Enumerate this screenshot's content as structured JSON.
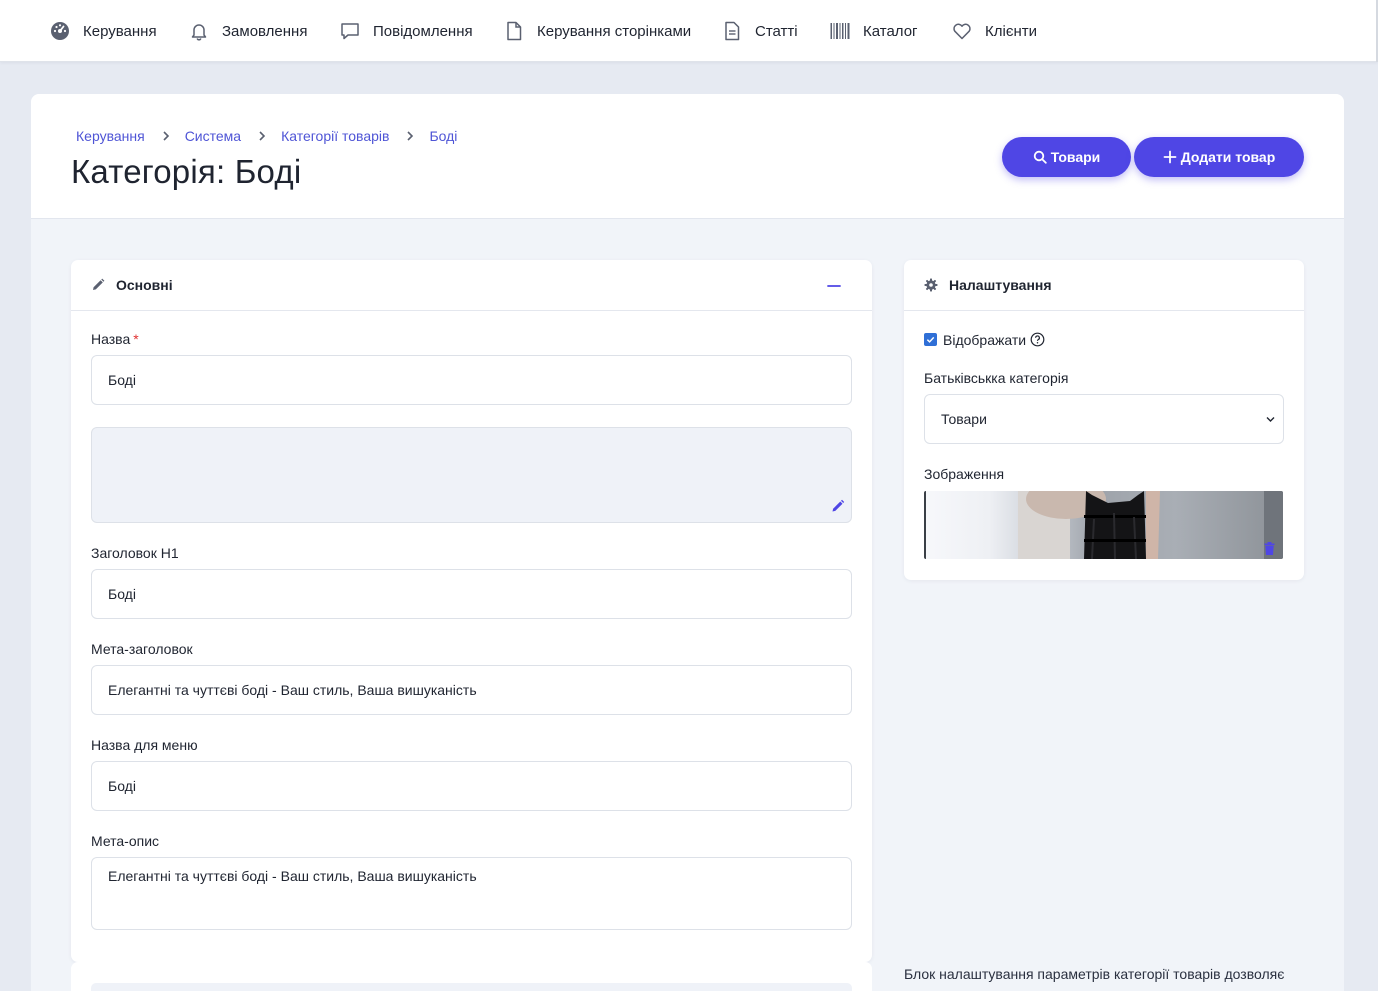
{
  "nav": {
    "items": [
      {
        "label": "Керування",
        "icon": "dashboard-icon"
      },
      {
        "label": "Замовлення",
        "icon": "bell-icon"
      },
      {
        "label": "Повідомлення",
        "icon": "chat-bubble-icon"
      },
      {
        "label": "Керування сторінками",
        "icon": "file-icon"
      },
      {
        "label": "Статті",
        "icon": "document-icon"
      },
      {
        "label": "Каталог",
        "icon": "barcode-icon"
      },
      {
        "label": "Клієнти",
        "icon": "heart-icon"
      }
    ]
  },
  "header": {
    "breadcrumb": [
      "Керування",
      "Система",
      "Категорії товарів",
      "Боді"
    ],
    "title": "Категорія: Боді",
    "products_button": "Товари",
    "add_product_button": "Додати товар"
  },
  "main_panel": {
    "title": "Основні",
    "name_label": "Назва",
    "required_mark": "*",
    "name_value": "Боді",
    "h1_label": "Заголовок H1",
    "h1_value": "Боді",
    "meta_title_label": "Мета-заголовок",
    "meta_title_value": "Елегантні та чуттєві боді - Ваш стиль, Ваша вишуканість",
    "menu_name_label": "Назва для меню",
    "menu_name_value": "Боді",
    "meta_desc_label": "Мета-опис",
    "meta_desc_value": "Елегантні та чуттєві боді - Ваш стиль, Ваша вишуканість"
  },
  "settings_panel": {
    "title": "Налаштування",
    "display_label": "Відображати",
    "display_checked": true,
    "parent_label": "Батьківськка категорія",
    "parent_value": "Товари",
    "image_label": "Зображення"
  },
  "info_text": "Блок налаштування параметрів категорії товарів дозволяє",
  "colors": {
    "accent": "#4f46e5",
    "link": "#4f55d6",
    "background": "#e6eaf2"
  }
}
